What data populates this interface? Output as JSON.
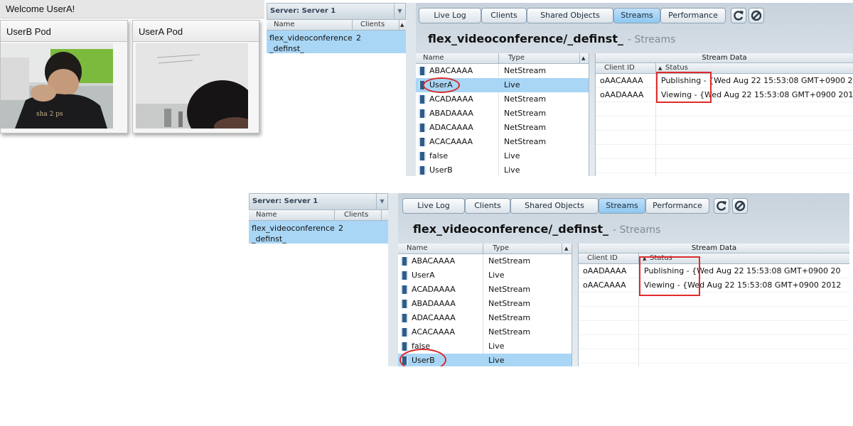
{
  "app": {
    "welcome": "Welcome UserA!",
    "pods": [
      {
        "title": "UserB Pod"
      },
      {
        "title": "UserA Pod"
      }
    ]
  },
  "consoles": [
    {
      "server_label": "Server: Server 1",
      "app_grid": {
        "col_name": "Name",
        "col_clients": "Clients",
        "row": {
          "name_line1": "flex_videoconference",
          "name_line2": "_definst_",
          "clients": "2"
        }
      },
      "tabs": [
        "Live Log",
        "Clients",
        "Shared Objects",
        "Streams",
        "Performance"
      ],
      "active_tab": "Streams",
      "title": "flex_videoconference/_definst_",
      "subtitle": "- Streams",
      "streams_header": {
        "name": "Name",
        "type": "Type"
      },
      "streams": [
        {
          "name": "ABACAAAA",
          "type": "NetStream"
        },
        {
          "name": "UserA",
          "type": "Live"
        },
        {
          "name": "ACADAAAA",
          "type": "NetStream"
        },
        {
          "name": "ABADAAAA",
          "type": "NetStream"
        },
        {
          "name": "ADACAAAA",
          "type": "NetStream"
        },
        {
          "name": "ACACAAAA",
          "type": "NetStream"
        },
        {
          "name": "false",
          "type": "Live"
        },
        {
          "name": "UserB",
          "type": "Live"
        }
      ],
      "selected_stream": "UserA",
      "stream_data": {
        "header": "Stream Data",
        "col_client": "Client ID",
        "col_status": "Status",
        "rows": [
          {
            "client": "oAACAAAA",
            "status": "Publishing - {Wed Aug 22 15:53:08 GMT+0900 2"
          },
          {
            "client": "oAADAAAA",
            "status": "Viewing - {Wed Aug 22 15:53:08 GMT+0900 201"
          }
        ]
      }
    },
    {
      "server_label": "Server: Server 1",
      "app_grid": {
        "col_name": "Name",
        "col_clients": "Clients",
        "row": {
          "name_line1": "flex_videoconference",
          "name_line2": "_definst_",
          "clients": "2"
        }
      },
      "tabs": [
        "Live Log",
        "Clients",
        "Shared Objects",
        "Streams",
        "Performance"
      ],
      "active_tab": "Streams",
      "title": "flex_videoconference/_definst_",
      "subtitle": "- Streams",
      "streams_header": {
        "name": "Name",
        "type": "Type"
      },
      "streams": [
        {
          "name": "ABACAAAA",
          "type": "NetStream"
        },
        {
          "name": "UserA",
          "type": "Live"
        },
        {
          "name": "ACADAAAA",
          "type": "NetStream"
        },
        {
          "name": "ABADAAAA",
          "type": "NetStream"
        },
        {
          "name": "ADACAAAA",
          "type": "NetStream"
        },
        {
          "name": "ACACAAAA",
          "type": "NetStream"
        },
        {
          "name": "false",
          "type": "Live"
        },
        {
          "name": "UserB",
          "type": "Live"
        }
      ],
      "selected_stream": "UserB",
      "stream_data": {
        "header": "Stream Data",
        "col_client": "Client ID",
        "col_status": "Status",
        "rows": [
          {
            "client": "oAADAAAA",
            "status": "Publishing - {Wed Aug 22 15:53:08 GMT+0900 20"
          },
          {
            "client": "oAACAAAA",
            "status": "Viewing - {Wed Aug 22 15:53:08 GMT+0900 2012"
          }
        ]
      }
    }
  ]
}
